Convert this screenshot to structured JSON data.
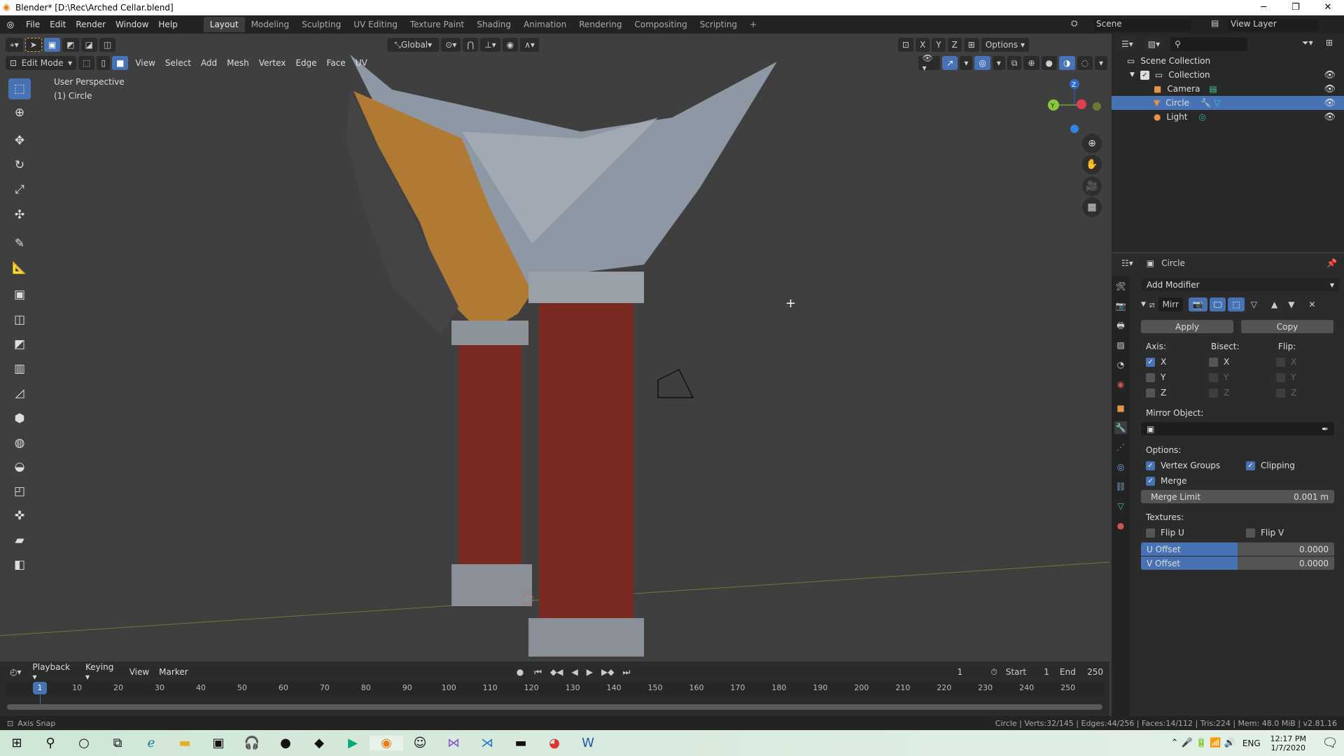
{
  "window": {
    "title": "Blender* [D:\\Rec\\Arched Cellar.blend]",
    "controls": [
      "─",
      "❐",
      "✕"
    ]
  },
  "menu": [
    "File",
    "Edit",
    "Render",
    "Window",
    "Help"
  ],
  "workspaces": [
    "Layout",
    "Modeling",
    "Sculpting",
    "UV Editing",
    "Texture Paint",
    "Shading",
    "Animation",
    "Rendering",
    "Compositing",
    "Scripting"
  ],
  "active_workspace": "Layout",
  "scene": {
    "label": "Scene",
    "view_layer": "View Layer"
  },
  "header": {
    "transform": "Global",
    "options": "Options",
    "axes": [
      "X",
      "Y",
      "Z"
    ]
  },
  "viewport_header": {
    "mode": "Edit Mode",
    "menus": [
      "View",
      "Select",
      "Add",
      "Mesh",
      "Vertex",
      "Edge",
      "Face",
      "UV"
    ]
  },
  "viewport": {
    "perspective": "User Perspective",
    "object": "(1) Circle",
    "gizmo": {
      "z": "Z",
      "y": "Y"
    }
  },
  "toolbar_icons": [
    "select-box",
    "cursor",
    "move",
    "rotate",
    "scale",
    "transform",
    "annotate",
    "measure",
    "extrude",
    "inset",
    "bevel",
    "loop-cut",
    "knife",
    "poly-build",
    "spin",
    "smooth",
    "edge-slide",
    "shrink-fatten",
    "shear",
    "rip"
  ],
  "outliner": {
    "root": "Scene Collection",
    "collection": "Collection",
    "items": [
      {
        "name": "Camera",
        "color": "#e5944a"
      },
      {
        "name": "Circle",
        "color": "#e5944a",
        "selected": true
      },
      {
        "name": "Light",
        "color": "#e5944a"
      }
    ]
  },
  "properties": {
    "object_name": "Circle",
    "add_modifier": "Add Modifier",
    "modifier_name": "Mirr",
    "apply": "Apply",
    "copy": "Copy",
    "axis_label": "Axis:",
    "bisect_label": "Bisect:",
    "flip_label": "Flip:",
    "axis": [
      {
        "l": "X",
        "on": true
      },
      {
        "l": "Y",
        "on": false
      },
      {
        "l": "Z",
        "on": false
      }
    ],
    "bisect": [
      {
        "l": "X",
        "on": false
      },
      {
        "l": "Y",
        "on": false
      },
      {
        "l": "Z",
        "on": false
      }
    ],
    "flip": [
      {
        "l": "X",
        "on": false
      },
      {
        "l": "Y",
        "on": false
      },
      {
        "l": "Z",
        "on": false
      }
    ],
    "mirror_object": "Mirror Object:",
    "options_label": "Options:",
    "vertex_groups": "Vertex Groups",
    "clipping": "Clipping",
    "merge": "Merge",
    "merge_limit_label": "Merge Limit",
    "merge_limit": "0.001 m",
    "textures_label": "Textures:",
    "flip_u": "Flip U",
    "flip_v": "Flip V",
    "u_offset_label": "U Offset",
    "u_offset": "0.0000",
    "v_offset_label": "V Offset",
    "v_offset": "0.0000"
  },
  "timeline": {
    "menus": [
      "Playback",
      "Keying",
      "View",
      "Marker"
    ],
    "current": "1",
    "start_label": "Start",
    "start": "1",
    "end_label": "End",
    "end": "250",
    "ticks": [
      "10",
      "20",
      "30",
      "40",
      "50",
      "60",
      "70",
      "80",
      "90",
      "100",
      "110",
      "120",
      "130",
      "140",
      "150",
      "160",
      "170",
      "180",
      "190",
      "200",
      "210",
      "220",
      "230",
      "240",
      "250"
    ],
    "frame_marker": "1"
  },
  "status": {
    "left": "Axis Snap",
    "right": "Circle | Verts:32/145 | Edges:44/256 | Faces:14/112 | Tris:224 | Mem: 48.0 MiB | v2.81.16"
  },
  "taskbar": {
    "lang": "ENG",
    "time": "12:17 PM",
    "date": "1/7/2020"
  },
  "colors": {
    "accent": "#4772b3",
    "bg": "#3d3d3d",
    "panel": "#2b2b2b"
  }
}
